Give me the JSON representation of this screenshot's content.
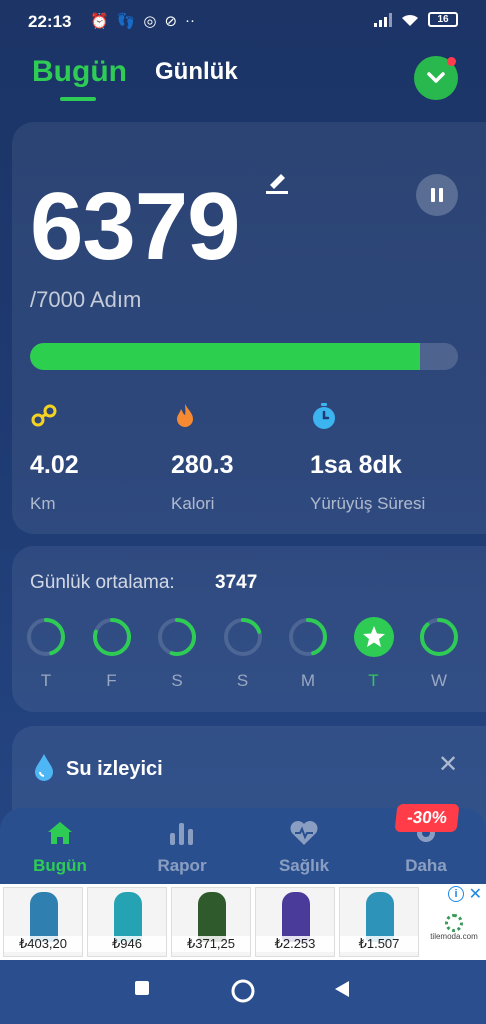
{
  "status_bar": {
    "time": "22:13",
    "battery": "16"
  },
  "tabs": {
    "today": "Bugün",
    "daily": "Günlük"
  },
  "steps": {
    "value": "6379",
    "goal_text": "/7000 Adım",
    "progress": 0.911
  },
  "stats": [
    {
      "value": "4.02",
      "label": "Km",
      "icon": "distance-icon"
    },
    {
      "value": "280.3",
      "label": "Kalori",
      "icon": "flame-icon"
    },
    {
      "value": "1sa 8dk",
      "label": "Yürüyüş Süresi",
      "icon": "timer-icon"
    }
  ],
  "weekly": {
    "average_label": "Günlük ortalama:",
    "average_value": "3747",
    "days": [
      {
        "label": "T",
        "level": 0.45
      },
      {
        "label": "F",
        "level": 0.8
      },
      {
        "label": "S",
        "level": 0.55
      },
      {
        "label": "S",
        "level": 0.2
      },
      {
        "label": "M",
        "level": 0.45
      },
      {
        "label": "T",
        "level": 1.0,
        "today": true
      },
      {
        "label": "W",
        "level": 0.88
      }
    ]
  },
  "water": {
    "title": "Su izleyici"
  },
  "bottom_nav": {
    "today": "Bugün",
    "report": "Rapor",
    "health": "Sağlık",
    "more": "Daha",
    "promo": "-30%"
  },
  "ad": {
    "prices": [
      "₺403,20",
      "₺946",
      "₺371,25",
      "₺2.253",
      "₺1.507"
    ],
    "brand": "tilemoda.com"
  },
  "colors": {
    "accent": "#2ecc55",
    "background": "#1f3b73",
    "promo": "#ff3c47"
  }
}
